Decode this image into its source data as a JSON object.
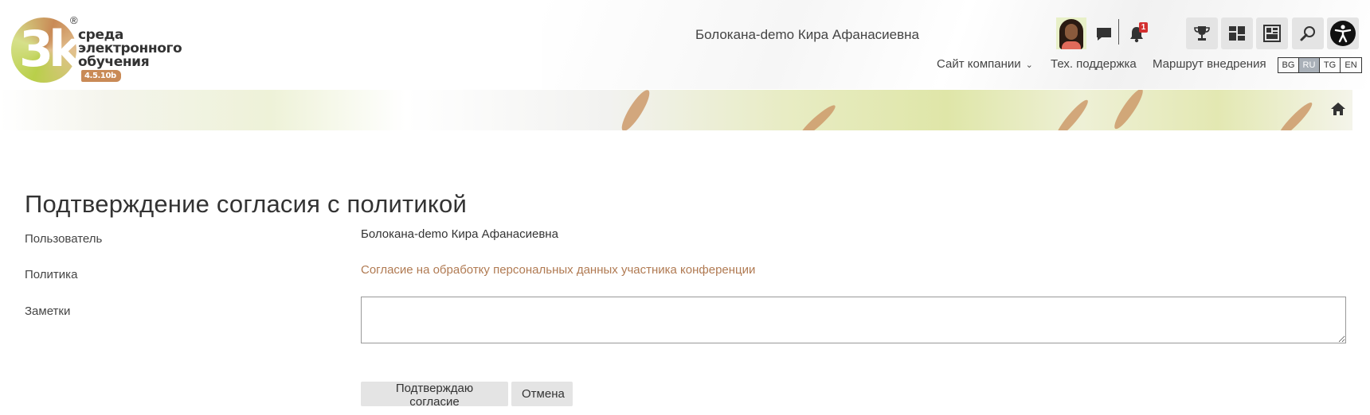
{
  "header": {
    "logo": {
      "mark": "3k",
      "registered": "®",
      "line1": "среда",
      "line2": "электронного",
      "line3": "обучения",
      "version": "4.5.10b"
    },
    "user_name": "Болокана-demo Кира Афанасиевна",
    "notifications_count": "1",
    "icons": {
      "messages": "chat-bubble-icon",
      "notifications": "bell-icon",
      "trophy": "trophy-icon",
      "layout": "layout-grid-icon",
      "blocks": "blocks-icon",
      "search": "search-icon",
      "accessibility": "accessibility-icon"
    },
    "nav": {
      "company_site": "Сайт компании",
      "support": "Тех. поддержка",
      "route": "Маршрут внедрения"
    },
    "languages": [
      {
        "code": "BG",
        "active": false
      },
      {
        "code": "RU",
        "active": true
      },
      {
        "code": "TG",
        "active": false
      },
      {
        "code": "EN",
        "active": false
      }
    ]
  },
  "banner": {
    "home_icon": "home-icon"
  },
  "main": {
    "title": "Подтверждение согласия с политикой",
    "fields": {
      "user_label": "Пользователь",
      "user_value": "Болокана-demo Кира Афанасиевна",
      "policy_label": "Политика",
      "policy_value": "Согласие на обработку персональных данных участника конференции",
      "notes_label": "Заметки",
      "notes_value": ""
    },
    "buttons": {
      "confirm": "Подтверждаю согласие",
      "cancel": "Отмена"
    }
  },
  "colors": {
    "link": "#b07a52",
    "accent_green": "#b9cf4a",
    "accent_brown": "#c98a56",
    "badge": "#d32f2f",
    "button_bg": "#e4e4e4"
  }
}
